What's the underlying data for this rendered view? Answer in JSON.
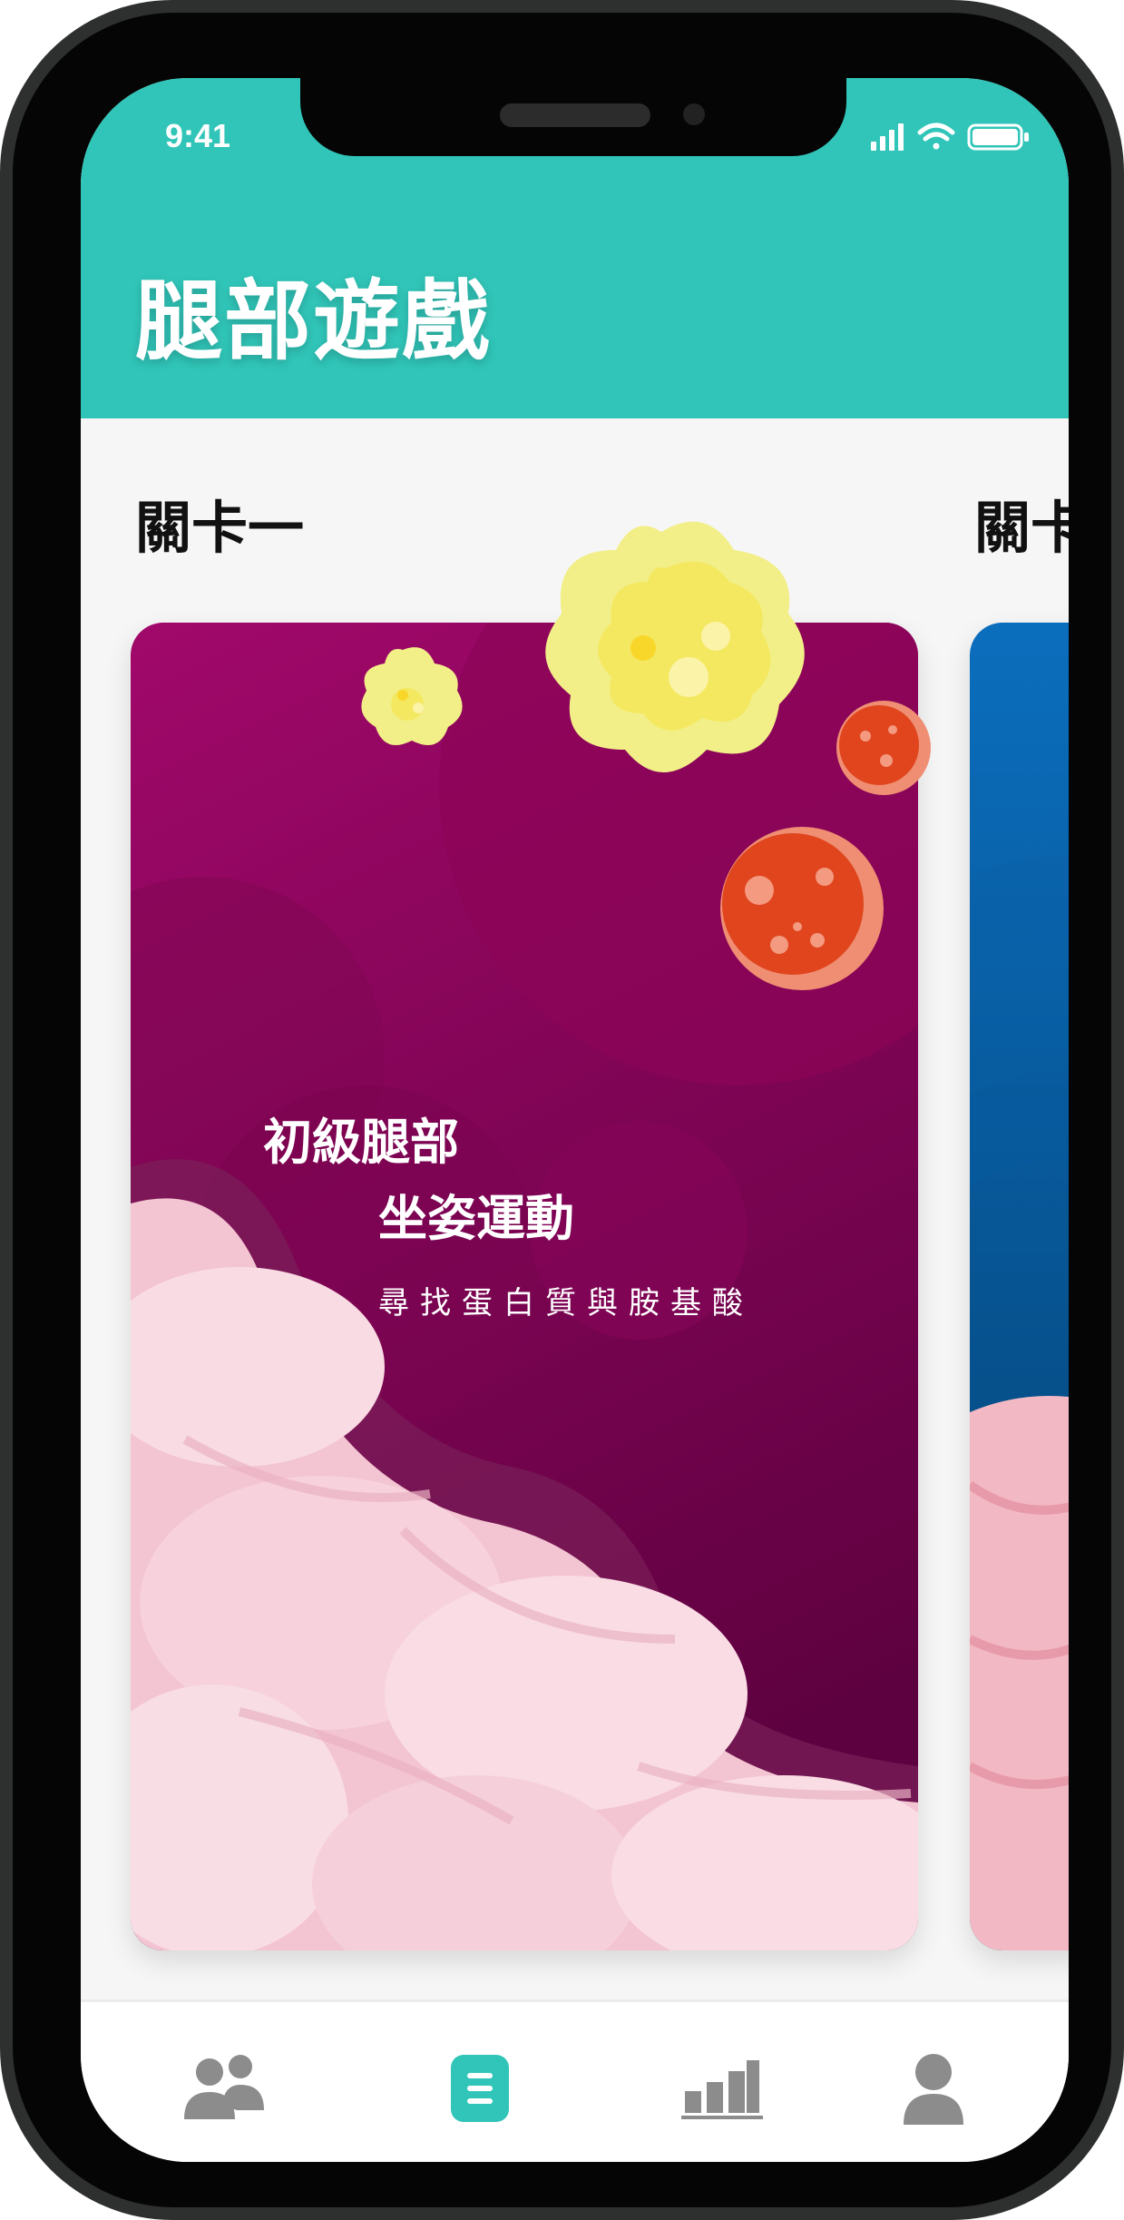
{
  "status_bar": {
    "time": "9:41"
  },
  "header": {
    "title": "腿部遊戲"
  },
  "levels": [
    {
      "label": "關卡一",
      "title_line1": "初級腿部",
      "title_line2": "坐姿運動",
      "subtitle": "尋找蛋白質與胺基酸"
    },
    {
      "label": "關卡"
    }
  ],
  "tab_bar": {
    "items": [
      {
        "icon": "group-icon",
        "active": false
      },
      {
        "icon": "list-icon",
        "active": true
      },
      {
        "icon": "bar-chart-icon",
        "active": false
      },
      {
        "icon": "profile-icon",
        "active": false
      }
    ]
  },
  "colors": {
    "header": "#30c5b8",
    "active_tab": "#30c5b8",
    "inactive_tab": "#8c8c8c",
    "card1_bg": "#8a0758",
    "card2_bg": "#0b5fa8"
  }
}
